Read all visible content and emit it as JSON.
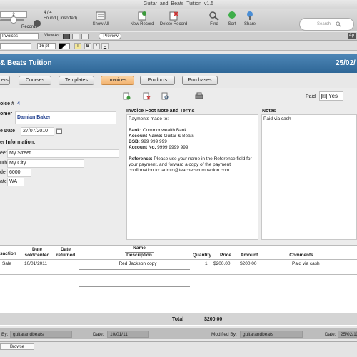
{
  "window": {
    "title": "Guitar_and_Beats_Tuition_v1.5"
  },
  "toolbar": {
    "record_input": "2",
    "found_count": "4 / 4",
    "found_status": "Found (Unsorted)",
    "records_label": "Records",
    "show_all": "Show All",
    "new_record": "New Record",
    "delete_record": "Delete Record",
    "find": "Find",
    "sort": "Sort",
    "share": "Share",
    "search_placeholder": "Search"
  },
  "layoutbar": {
    "layout_value": "Invoices",
    "view_as": "View As:",
    "preview": "Preview",
    "aa": "Aµ"
  },
  "formatbar": {
    "size": "16 pt",
    "bold": "B",
    "italic": "I",
    "underline": "U",
    "highlight": "T"
  },
  "header": {
    "title": "& Beats Tuition",
    "date": "25/02/"
  },
  "nav": [
    "mers",
    "Courses",
    "Templates",
    "Invoices",
    "Products",
    "Purchases"
  ],
  "form": {
    "invoice_label": "oice #",
    "invoice_no": "4",
    "customer_label": "omer",
    "customer": "Damian Baker",
    "date_label": "e Date",
    "date": "27/07/2010",
    "cust_info_label": "er Information:",
    "street_label": "eet",
    "street": "My Street",
    "suburb_label": "urb",
    "suburb": "My City",
    "code_label": "de",
    "code": "6000",
    "state_label": "ate",
    "state": "WA",
    "paid_label": "Paid",
    "paid_value": "Yes",
    "footnote_title": "Invoice Foot Note and Terms",
    "footnote": {
      "l1": "Payments made to:",
      "l2": "Bank:",
      "l2v": " Commonwealth Bank",
      "l3": "Account Name:",
      "l3v": " Guitar & Beats",
      "l4": "BSB:",
      "l4v": " 999 999 999",
      "l5": "Account No.",
      "l5v": " 9999 9999 999",
      "l6": "Reference:",
      "l6v": " Please use your name in the Reference field for",
      "l7": "your payment, and forward a copy of the payment",
      "l8": "confirmation to: admin@teacherscompanion.com"
    },
    "notes_title": "Notes",
    "notes": "Paid via cash"
  },
  "table": {
    "headers": {
      "transaction": "saction",
      "date_sold": "Date\nsold/rented",
      "date_returned": "Date\nreturned",
      "name": "Name",
      "description": "Description",
      "quantity": "Quantity",
      "price": "Price",
      "amount": "Amount",
      "comments": "Comments"
    },
    "rows": [
      {
        "transaction": "Sale",
        "date_sold": "10/01/2011",
        "date_returned": "",
        "description": "Red Jackson copy",
        "quantity": "1",
        "price": "$200.00",
        "amount": "$200.00",
        "comments": "Paid via cash"
      }
    ],
    "total_label": "Total",
    "total": "$200.00"
  },
  "footer": {
    "created_by_label": "By:",
    "created_by": "guitarandbeats",
    "date_label": "Date:",
    "date": "10/01/11",
    "modified_by_label": "Modified By:",
    "modified_by": "guitarandbeats",
    "date2_label": "Date:",
    "date2": "25/02/11"
  },
  "status": {
    "mode": "Browse"
  },
  "colors": {
    "header_blue": "#3a76a8",
    "active_tab": "#f5c08a",
    "name_blue": "#1f3f8f"
  }
}
